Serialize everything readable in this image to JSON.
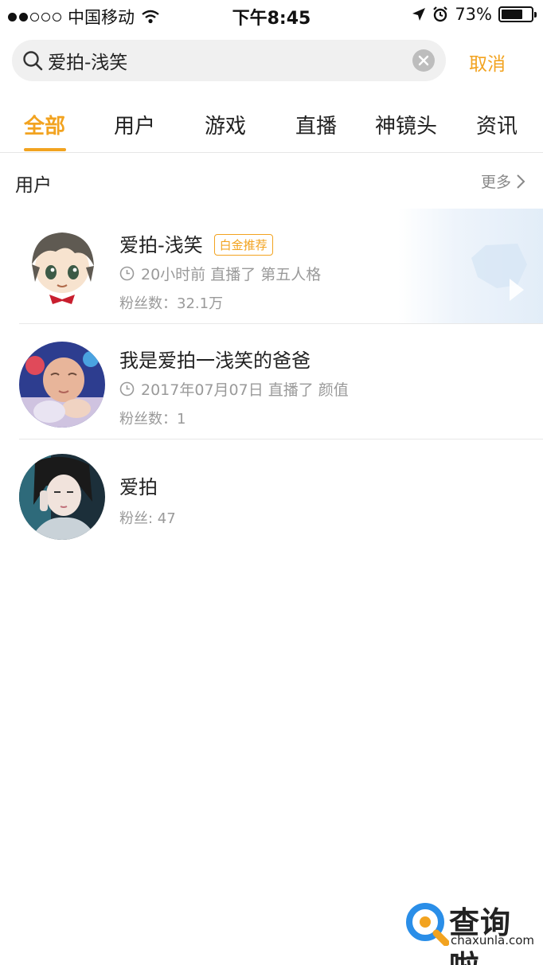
{
  "status_bar": {
    "carrier": "中国移动",
    "time": "下午8:45",
    "battery_percent": "73%",
    "battery_level": 0.73
  },
  "search": {
    "query": "爱拍-浅笑",
    "cancel_label": "取消"
  },
  "tabs": [
    {
      "label": "全部",
      "active": true
    },
    {
      "label": "用户",
      "active": false
    },
    {
      "label": "游戏",
      "active": false
    },
    {
      "label": "直播",
      "active": false
    },
    {
      "label": "神镜头",
      "active": false
    },
    {
      "label": "资讯",
      "active": false
    }
  ],
  "section": {
    "title": "用户",
    "more_label": "更多"
  },
  "users": [
    {
      "name": "爱拍-浅笑",
      "badge": "白金推荐",
      "activity": "20小时前 直播了 第五人格",
      "followers": "粉丝数：32.1万"
    },
    {
      "name": "我是爱拍一浅笑的爸爸",
      "activity": "2017年07月07日 直播了 颜值",
      "followers": "粉丝数：1"
    },
    {
      "name": "爱拍",
      "followers": "粉丝: 47"
    }
  ],
  "watermark": {
    "brand": "查询啦",
    "url": "chaxunla.com"
  },
  "colors": {
    "accent": "#f2a320",
    "secondary_text": "#9a9a9a",
    "divider": "#e8e8e8"
  }
}
